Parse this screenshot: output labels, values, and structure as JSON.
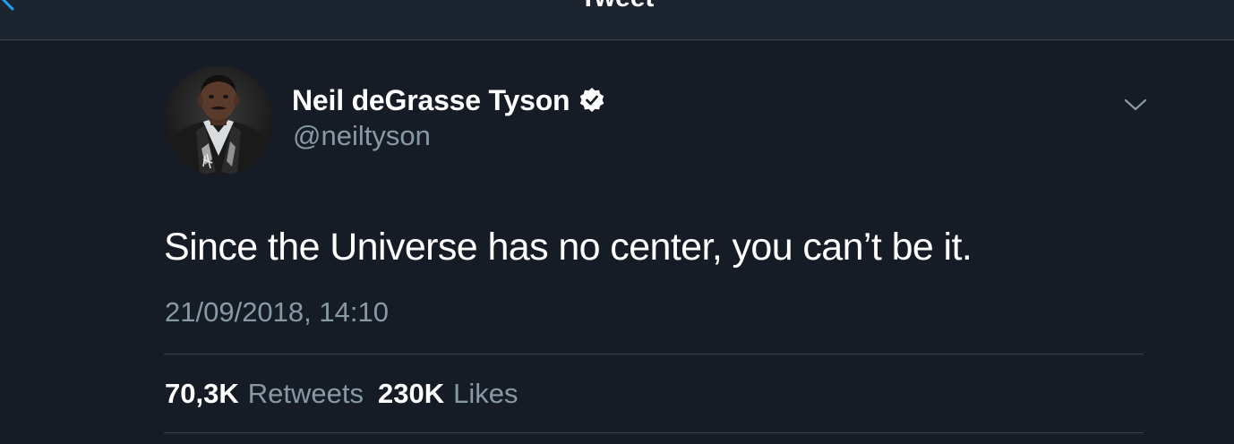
{
  "nav": {
    "title": "Tweet",
    "back_icon": "chevron-left-icon",
    "accent_color": "#1da1f2"
  },
  "tweet": {
    "author": {
      "name": "Neil deGrasse Tyson",
      "handle": "@neiltyson",
      "verified": true,
      "verified_icon": "verified-badge-icon"
    },
    "more_icon": "chevron-down-icon",
    "text": "Since the Universe has no center, you can’t be it.",
    "timestamp": "21/09/2018, 14:10",
    "stats": {
      "retweets_count": "70,3K",
      "retweets_label": "Retweets",
      "likes_count": "230K",
      "likes_label": "Likes"
    }
  },
  "colors": {
    "background": "#161c25",
    "nav_background": "#1c2430",
    "divider": "#38444d",
    "secondary_text": "#8899a6"
  }
}
